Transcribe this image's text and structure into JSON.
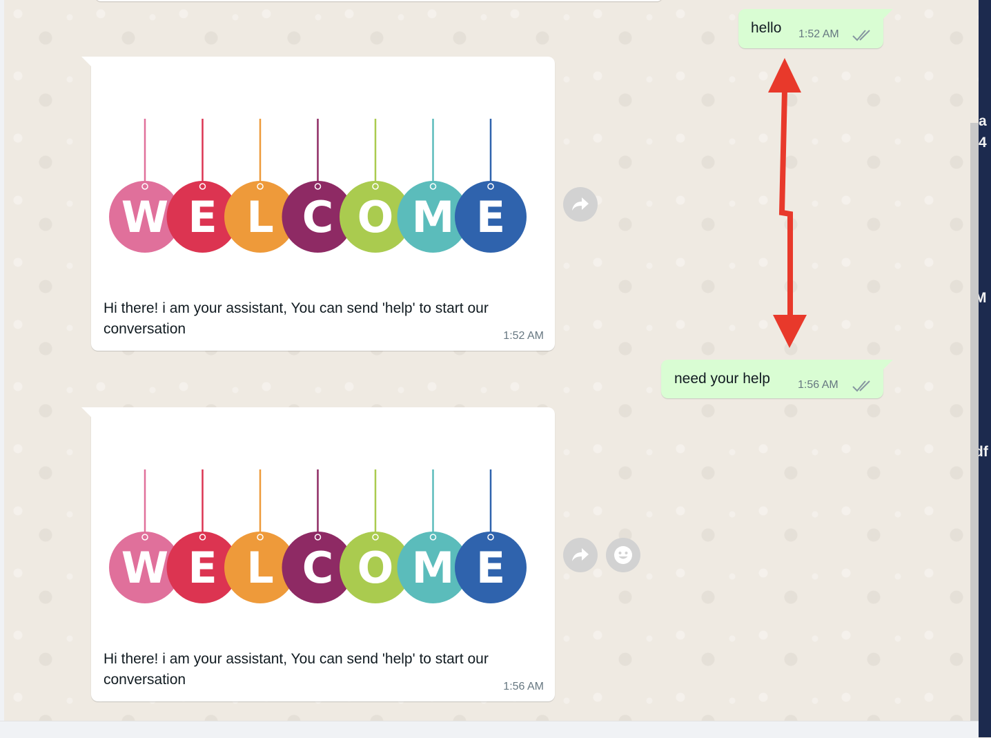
{
  "messages": [
    {
      "direction": "out",
      "text": "hello",
      "time": "1:52 AM",
      "status": "read-double-check"
    },
    {
      "direction": "in",
      "image": "welcome-banner",
      "banner_letters": [
        "W",
        "E",
        "L",
        "C",
        "O",
        "M",
        "E"
      ],
      "caption": "Hi there! i am your assistant, You can send 'help' to start our conversation",
      "time": "1:52 AM"
    },
    {
      "direction": "out",
      "text": "need your help",
      "time": "1:56 AM",
      "status": "read-double-check"
    },
    {
      "direction": "in",
      "image": "welcome-banner",
      "banner_letters": [
        "W",
        "E",
        "L",
        "C",
        "O",
        "M",
        "E"
      ],
      "caption": "Hi there! i am your assistant, You can send 'help' to start our conversation",
      "time": "1:56 AM"
    }
  ],
  "banner_colors": [
    "#e0709b",
    "#dc3451",
    "#ee9a3a",
    "#8e2a64",
    "#aacb4f",
    "#5bbcbb",
    "#2f63ad"
  ],
  "icons": {
    "forward": "forward-arrow-icon",
    "react": "emoji-smile-icon",
    "status": "double-check-icon"
  },
  "annotation": {
    "type": "double-headed-arrow",
    "color": "#e8392b"
  },
  "right_edge_fragments": [
    "a",
    "4",
    "M",
    "df"
  ],
  "colors": {
    "chat_background": "#efeae2",
    "outgoing_bubble": "#d9fdd3",
    "incoming_bubble": "#ffffff",
    "tick": "#8696a0",
    "timestamp": "#667781"
  }
}
